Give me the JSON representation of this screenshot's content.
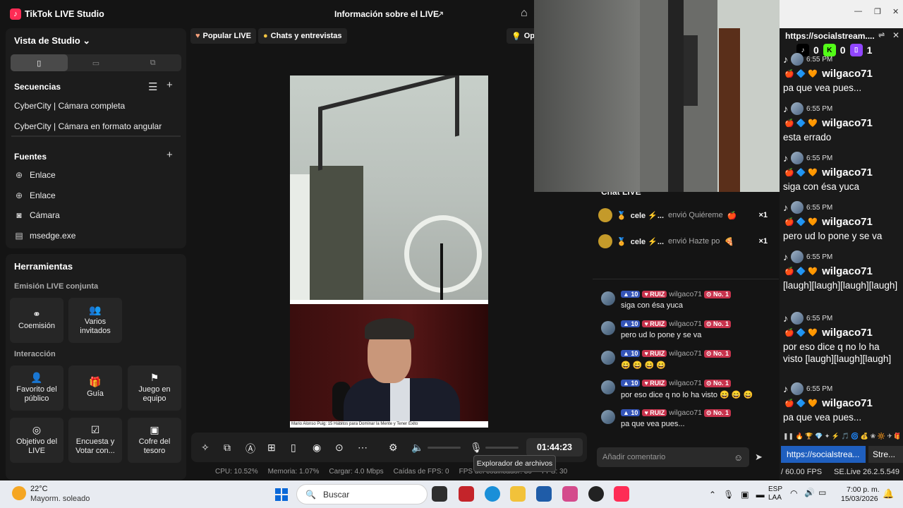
{
  "app": {
    "title": "TikTok LIVE Studio",
    "live_info": "Información sobre el LIVE",
    "logo_glyph": "♪"
  },
  "studio": {
    "view_label": "Vista de Studio ⌄",
    "sequences_label": "Secuencias",
    "sequences": [
      "CyberCity | Cámara completa",
      "CyberCity | Cámara en formato angular"
    ],
    "sources_label": "Fuentes",
    "sources": [
      {
        "icon": "globe-icon",
        "label": "Enlace"
      },
      {
        "icon": "globe-icon",
        "label": "Enlace"
      },
      {
        "icon": "camera-icon",
        "label": "Cámara"
      },
      {
        "icon": "window-icon",
        "label": "msedge.exe"
      }
    ]
  },
  "tools": {
    "title": "Herramientas",
    "joint_live_label": "Emisión LIVE conjunta",
    "joint_live": [
      {
        "icon": "link-icon",
        "label": "Coemisión"
      },
      {
        "icon": "users-icon",
        "label": "Varios invitados"
      }
    ],
    "interaction_label": "Interacción",
    "interaction": [
      {
        "icon": "heart-user-icon",
        "label": "Favorito del público"
      },
      {
        "icon": "gift-icon",
        "label": "Guía"
      },
      {
        "icon": "team-icon",
        "label": "Juego en equipo"
      },
      {
        "icon": "target-icon",
        "label": "Objetivo del LIVE"
      },
      {
        "icon": "poll-icon",
        "label": "Encuesta y Votar con..."
      },
      {
        "icon": "chest-icon",
        "label": "Cofre del tesoro"
      }
    ]
  },
  "stream": {
    "tab_popular": "Popular LIVE",
    "tab_chats": "Chats y entrevistas",
    "tab_opt": "Opt",
    "caption": "Mario Alonso Puig: 15 Hábitos para Dominar la Mente y Tener Éxito",
    "timer": "01:44:23",
    "tooltip": "Explorador de archivos"
  },
  "status": {
    "cpu": "CPU: 10.52%",
    "memory": "Memoria: 1.07%",
    "upload": "Cargar: 4.0 Mbps",
    "fps_drops": "Caídas de FPS: 0",
    "encoder_fps": "FPS del codificador: 30",
    "fps": "FPS: 30"
  },
  "chat": {
    "label": "Chat LIVE",
    "gifts": [
      {
        "user": "cele ⚡...",
        "action": "envió Quiéreme",
        "count": "×1"
      },
      {
        "user": "cele ⚡...",
        "action": "envió Hazte po",
        "count": "×1"
      }
    ],
    "messages": [
      {
        "level": "10",
        "fan": "RUIZ",
        "user": "wilgaco71",
        "rank": "No. 1",
        "text": "siga con ésa yuca"
      },
      {
        "level": "10",
        "fan": "RUIZ",
        "user": "wilgaco71",
        "rank": "No. 1",
        "text": "pero ud lo pone y se va"
      },
      {
        "level": "10",
        "fan": "RUIZ",
        "user": "wilgaco71",
        "rank": "No. 1",
        "text": "😄 😄 😄 😄"
      },
      {
        "level": "10",
        "fan": "RUIZ",
        "user": "wilgaco71",
        "rank": "No. 1",
        "text": "por eso dice q no lo ha visto 😄 😄 😄"
      },
      {
        "level": "10",
        "fan": "RUIZ",
        "user": "wilgaco71",
        "rank": "No. 1",
        "text": "pa que vea pues..."
      }
    ],
    "comment_placeholder": "Añadir comentario"
  },
  "socialstream": {
    "url": "https://socialstream....",
    "counts": [
      {
        "platform": "tiktok",
        "value": "0",
        "color": "#000000"
      },
      {
        "platform": "kick",
        "value": "0",
        "color": "#53fc18"
      },
      {
        "platform": "twitch",
        "value": "1",
        "color": "#9146ff"
      }
    ],
    "messages": [
      {
        "time": "6:55 PM",
        "name": "wilgaco71",
        "text": "pa que vea pues..."
      },
      {
        "time": "6:55 PM",
        "name": "wilgaco71",
        "text": "esta errado"
      },
      {
        "time": "6:55 PM",
        "name": "wilgaco71",
        "text": "siga con ésa yuca"
      },
      {
        "time": "6:55 PM",
        "name": "wilgaco71",
        "text": "pero ud lo pone y se va"
      },
      {
        "time": "6:55 PM",
        "name": "wilgaco71",
        "text": "[laugh][laugh][laugh][laugh]"
      },
      {
        "time": "6:55 PM",
        "name": "wilgaco71",
        "text": "por eso dice q no lo ha visto [laugh][laugh][laugh]"
      },
      {
        "time": "6:55 PM",
        "name": "wilgaco71",
        "text": "pa que vea pues..."
      }
    ],
    "tab_a": "https://socialstrea...",
    "tab_b": "Stre...",
    "fps": "/ 60.00 FPS",
    "version": "SE.Live 26.2.5.549"
  },
  "taskbar": {
    "temp": "22°C",
    "weather": "Mayorm. soleado",
    "search": "Buscar",
    "lang_top": "ESP",
    "lang_bottom": "LAA",
    "time": "7:00 p. m.",
    "date": "15/03/2026"
  }
}
